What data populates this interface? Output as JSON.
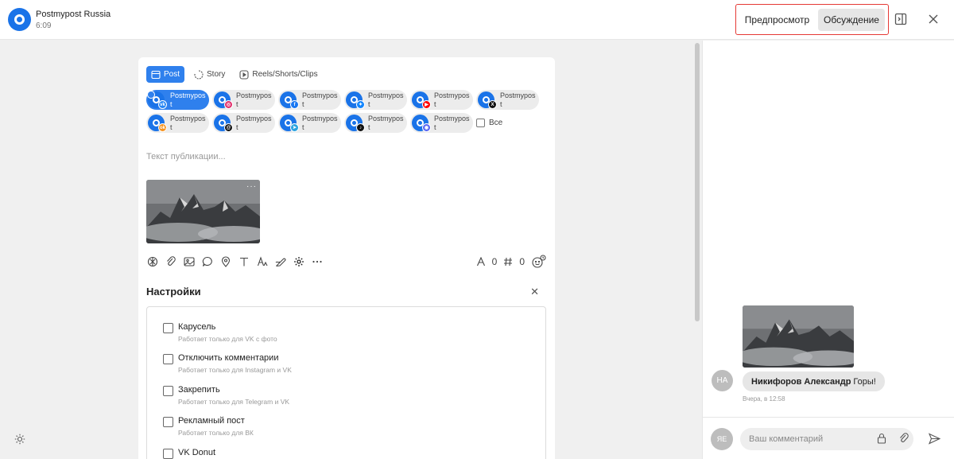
{
  "header": {
    "app_name": "Postmypost Russia",
    "time": "6:09",
    "tab_preview": "Предпросмотр",
    "tab_discussion": "Обсуждение"
  },
  "composer": {
    "type_tabs": [
      "Post",
      "Story",
      "Reels/Shorts/Clips"
    ],
    "accounts": [
      {
        "label": "Postmypost",
        "network": "vk",
        "color": "#2787f5",
        "selected": true
      },
      {
        "label": "Postmypost",
        "network": "instagram",
        "color": "#e1306c",
        "selected": false
      },
      {
        "label": "Postmypost",
        "network": "facebook",
        "color": "#1877f2",
        "selected": false
      },
      {
        "label": "Postmypost",
        "network": "bluesky",
        "color": "#1185fe",
        "selected": false
      },
      {
        "label": "Postmypost",
        "network": "youtube",
        "color": "#ff0000",
        "selected": false
      },
      {
        "label": "Postmypost",
        "network": "x",
        "color": "#111111",
        "selected": false
      },
      {
        "label": "Postmypost",
        "network": "ok",
        "color": "#f7931e",
        "selected": false
      },
      {
        "label": "Postmypost",
        "network": "threads",
        "color": "#111111",
        "selected": false
      },
      {
        "label": "Postmypost",
        "network": "telegram",
        "color": "#2aa3df",
        "selected": false
      },
      {
        "label": "Postmypost",
        "network": "tiktok",
        "color": "#111111",
        "selected": false
      },
      {
        "label": "Postmypost",
        "network": "discord",
        "color": "#5865f2",
        "selected": false
      }
    ],
    "all_label": "Все",
    "text_placeholder": "Текст публикации...",
    "media_more": "···",
    "toolbar_icons": [
      "openai-icon",
      "attach-icon",
      "image-icon",
      "comment-icon",
      "location-icon",
      "text-icon",
      "font-icon",
      "signature-icon",
      "settings-icon",
      "more-icon"
    ],
    "char_count": "0",
    "hashtag_count": "0"
  },
  "settings": {
    "title": "Настройки",
    "options": [
      {
        "label": "Карусель",
        "hint": "Работает только для VK с фото"
      },
      {
        "label": "Отключить комментарии",
        "hint": "Работает только для Instagram и VK"
      },
      {
        "label": "Закрепить",
        "hint": "Работает только для Telegram и VK"
      },
      {
        "label": "Рекламный пост",
        "hint": "Работает только для ВК"
      },
      {
        "label": "VK Donut",
        "hint": ""
      }
    ]
  },
  "discussion": {
    "author_initials": "НА",
    "author_name": "Никифоров Александр",
    "message": "Горы!",
    "timestamp": "Вчера, в 12:58",
    "me_initials": "ЯЕ",
    "input_placeholder": "Ваш комментарий"
  }
}
